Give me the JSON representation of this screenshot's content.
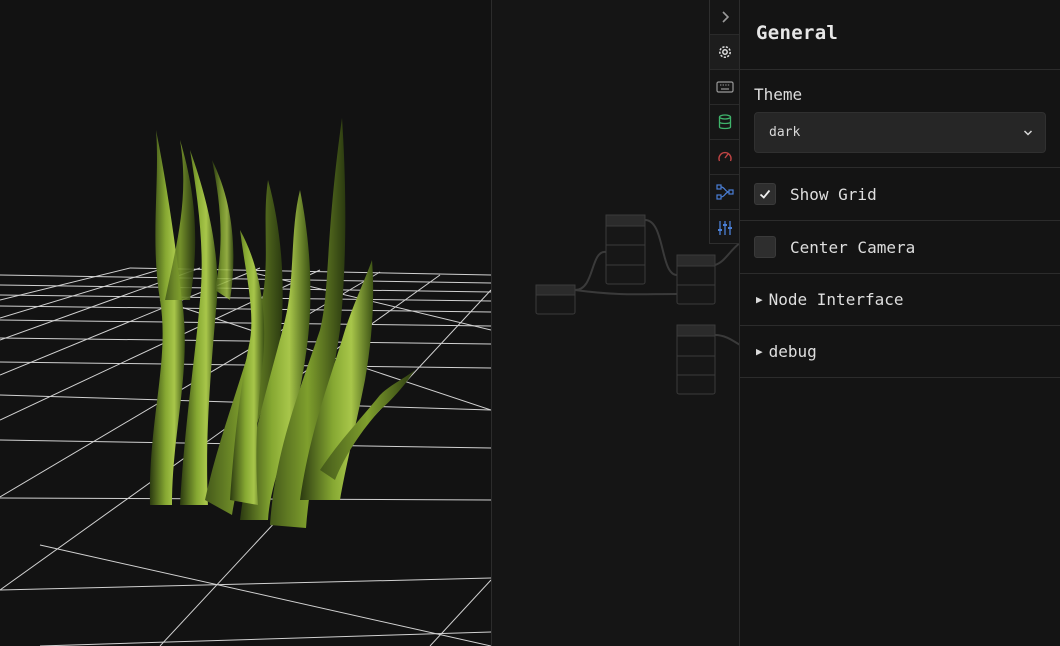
{
  "panel": {
    "title": "General",
    "theme": {
      "label": "Theme",
      "value": "dark"
    },
    "show_grid": {
      "label": "Show Grid",
      "checked": true
    },
    "center_camera": {
      "label": "Center Camera",
      "checked": false
    },
    "node_interface": {
      "label": "Node Interface",
      "expanded": false
    },
    "debug": {
      "label": "debug",
      "expanded": false
    }
  },
  "toolbar": [
    {
      "icon": "chevron-right-icon",
      "color": "#9a9a9a"
    },
    {
      "icon": "gear-icon",
      "color": "#e0e0e0",
      "active": true
    },
    {
      "icon": "keyboard-icon",
      "color": "#9a9a9a"
    },
    {
      "icon": "database-icon",
      "color": "#3fb36b"
    },
    {
      "icon": "gauge-icon",
      "color": "#c04444"
    },
    {
      "icon": "node-graph-icon",
      "color": "#4a7fd6"
    },
    {
      "icon": "sliders-icon",
      "color": "#4a7fd6"
    }
  ],
  "colors": {
    "background": "#131313",
    "panel_bg": "#141414",
    "grid_line": "#e8e8e8",
    "plant_green": "#7a9a2e"
  }
}
